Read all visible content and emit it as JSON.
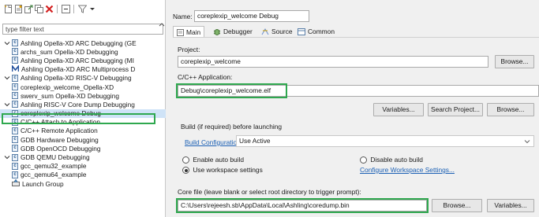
{
  "filter": {
    "placeholder": "type filter text"
  },
  "tree": [
    {
      "label": "Ashling Opella-XD ARC Debugging (GE",
      "level": 0,
      "expanded": true,
      "icon": "c"
    },
    {
      "label": "archs_sum Opella-XD Debugging",
      "level": 1,
      "icon": "c"
    },
    {
      "label": "Ashling Opella-XD ARC Debugging (MI",
      "level": 0,
      "icon": "c"
    },
    {
      "label": "Ashling Opella-XD ARC Multiprocess D",
      "level": 0,
      "icon": "m"
    },
    {
      "label": "Ashling Opella-XD RISC-V Debugging",
      "level": 0,
      "expanded": true,
      "icon": "c"
    },
    {
      "label": "coreplexip_welcome_Opella-XD",
      "level": 1,
      "icon": "c"
    },
    {
      "label": "swerv_sum Opella-XD Debugging",
      "level": 1,
      "icon": "c"
    },
    {
      "label": "Ashling RISC-V Core Dump Debugging",
      "level": 0,
      "expanded": true,
      "icon": "c"
    },
    {
      "label": "coreplexip_welcome Debug",
      "level": 1,
      "icon": "c",
      "selected": true
    },
    {
      "label": "C/C++ Attach to Application",
      "level": 0,
      "icon": "c"
    },
    {
      "label": "C/C++ Remote Application",
      "level": 0,
      "icon": "c"
    },
    {
      "label": "GDB Hardware Debugging",
      "level": 0,
      "icon": "c"
    },
    {
      "label": "GDB OpenOCD Debugging",
      "level": 0,
      "icon": "c"
    },
    {
      "label": "GDB QEMU Debugging",
      "level": 0,
      "expanded": true,
      "icon": "c"
    },
    {
      "label": "gcc_qemu32_example",
      "level": 1,
      "icon": "c"
    },
    {
      "label": "gcc_qemu64_example",
      "level": 1,
      "icon": "c"
    },
    {
      "label": "Launch Group",
      "level": 0,
      "icon": "launch"
    }
  ],
  "config": {
    "name_label": "Name:",
    "name_value": "coreplexip_welcome Debug",
    "tabs": [
      {
        "label": "Main",
        "icon": "main-icon"
      },
      {
        "label": "Debugger",
        "icon": "debugger-icon"
      },
      {
        "label": "Source",
        "icon": "source-icon"
      },
      {
        "label": "Common",
        "icon": "common-icon"
      }
    ],
    "project_label": "Project:",
    "project_value": "coreplexip_welcome",
    "browse_label": "Browse...",
    "app_label": "C/C++ Application:",
    "app_value": "Debug\\coreplexip_welcome.elf",
    "variables_label": "Variables...",
    "search_project_label": "Search Project...",
    "build_label": "Build (if required) before launching",
    "build_config_link": "Build Configuration:",
    "build_config_value": "Use Active",
    "enable_auto_build": "Enable auto build",
    "disable_auto_build": "Disable auto build",
    "use_workspace_settings": "Use workspace settings",
    "configure_link": "Configure Workspace Settings...",
    "core_label": "Core file (leave blank or select root directory to trigger prompt):",
    "core_value": "C:\\Users\\rejeesh.sb\\AppData\\Local\\Ashling\\coredump.bin"
  },
  "colors": {
    "highlight": "#2fa84f",
    "link": "#1a5fb4",
    "selection": "#cfe3f7"
  }
}
